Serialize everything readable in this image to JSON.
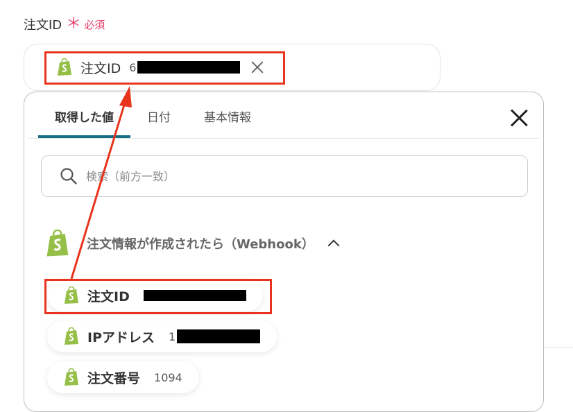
{
  "field": {
    "label": "注文ID",
    "required_mark": "＊",
    "required_text": "必須",
    "selected_chip": {
      "label": "注文ID",
      "value_prefix": "6"
    }
  },
  "picker": {
    "tabs": [
      {
        "label": "取得した値",
        "active": true
      },
      {
        "label": "日付",
        "active": false
      },
      {
        "label": "基本情報",
        "active": false
      }
    ],
    "search_placeholder": "検索（前方一致）",
    "group": {
      "title": "注文情報が作成されたら（Webhook）",
      "icon": "shopify-icon",
      "expanded": true
    },
    "items": [
      {
        "label": "注文ID",
        "value": ""
      },
      {
        "label": "IPアドレス",
        "value": "1"
      },
      {
        "label": "注文番号",
        "value": "1094"
      }
    ]
  },
  "colors": {
    "highlight": "#e8341c",
    "required": "#e8426b",
    "tab_underline": "#176e84",
    "shopify_green": "#95bf47"
  }
}
